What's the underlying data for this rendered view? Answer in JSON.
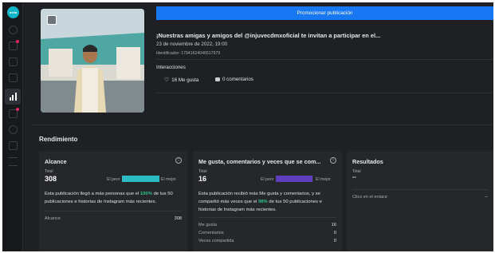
{
  "app": {
    "logo_text": "meta"
  },
  "rail": {
    "icons": [
      "home-icon",
      "pencil-icon",
      "calendar-icon",
      "list-icon",
      "insights-icon",
      "ads-icon",
      "dollar-icon",
      "tag-icon",
      "menu-icon"
    ]
  },
  "post": {
    "promote_label": "Promocionar publicación",
    "title": "¡Nuestras amigas y amigos del @injuvecdmxoficial te invitan a participar en el...",
    "date": "23 de noviembre de 2022, 19:00",
    "id_label": "Identificador: 17941624046517979",
    "interactions_label": "Interacciones",
    "likes_label": "16 Me gusta",
    "comments_label": "0 comentarios"
  },
  "performance": {
    "section_title": "Rendimiento",
    "reach": {
      "title": "Alcance",
      "total_label": "Total",
      "total_value": "308",
      "worst_label": "El peor",
      "best_label": "El mejor",
      "bar_color": "#2bbbc2",
      "bar_fill": 1.0,
      "desc_pre": "Esta publicación llegó a más personas que el ",
      "desc_highlight": "100%",
      "desc_post": " de tus 50 publicaciones e historias de Instagram más recientes.",
      "rows": [
        {
          "label": "Alcance",
          "value": "308"
        }
      ]
    },
    "engagement": {
      "title": "Me gusta, comentarios y veces que se com...",
      "total_label": "Total",
      "total_value": "16",
      "worst_label": "El peor",
      "best_label": "El mejor",
      "bar_color": "#5f3fbf",
      "bar_fill": 0.98,
      "desc_pre": "Esta publicación recibió más Me gusta y comentarios, y se compartió más veces que el ",
      "desc_highlight": "98%",
      "desc_post": " de tus 50 publicaciones e historias de Instagram más recientes.",
      "rows": [
        {
          "label": "Me gusta",
          "value": "16"
        },
        {
          "label": "Comentarios",
          "value": "0"
        },
        {
          "label": "Veces compartida",
          "value": "0"
        }
      ]
    },
    "results": {
      "title": "Resultados",
      "total_label": "Total",
      "total_value": "--",
      "rows": [
        {
          "label": "Clics en el enlace",
          "value": "--"
        }
      ]
    }
  },
  "colors": {
    "accent": "#1877f2",
    "highlight": "#2ec38a",
    "background": "#1e2024",
    "card": "#25272b"
  }
}
